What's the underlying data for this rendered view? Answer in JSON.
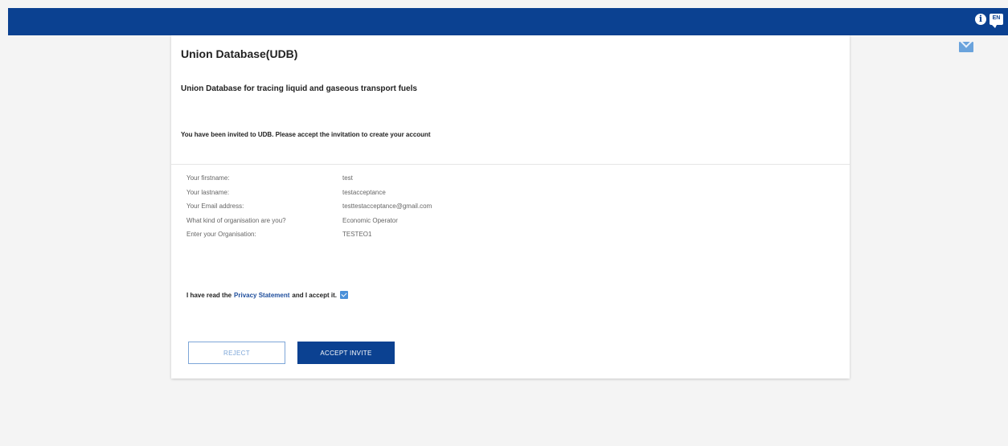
{
  "topbar": {
    "info_icon": "info-icon",
    "lang_icon": "language-icon",
    "lang_label": "EN",
    "color": "#0b4191"
  },
  "mail_icon": "mail-icon",
  "card": {
    "title": "Union Database(UDB)",
    "subtitle": "Union Database for tracing liquid and gaseous transport fuels",
    "invite_text": "You have been invited to UDB. Please accept the invitation to create your account"
  },
  "details": [
    {
      "label": "Your firstname:",
      "value": "test"
    },
    {
      "label": "Your lastname:",
      "value": "testacceptance"
    },
    {
      "label": "Your Email address:",
      "value": "testtestacceptance@gmail.com"
    },
    {
      "label": "What kind of organisation are you?",
      "value": "Economic Operator"
    },
    {
      "label": "Enter your Organisation:",
      "value": "TESTEO1"
    }
  ],
  "consent": {
    "prefix": "I have read the",
    "link": "Privacy Statement",
    "suffix": "and I accept it.",
    "checked": true
  },
  "buttons": {
    "reject": "REJECT",
    "accept": "ACCEPT INVITE"
  }
}
